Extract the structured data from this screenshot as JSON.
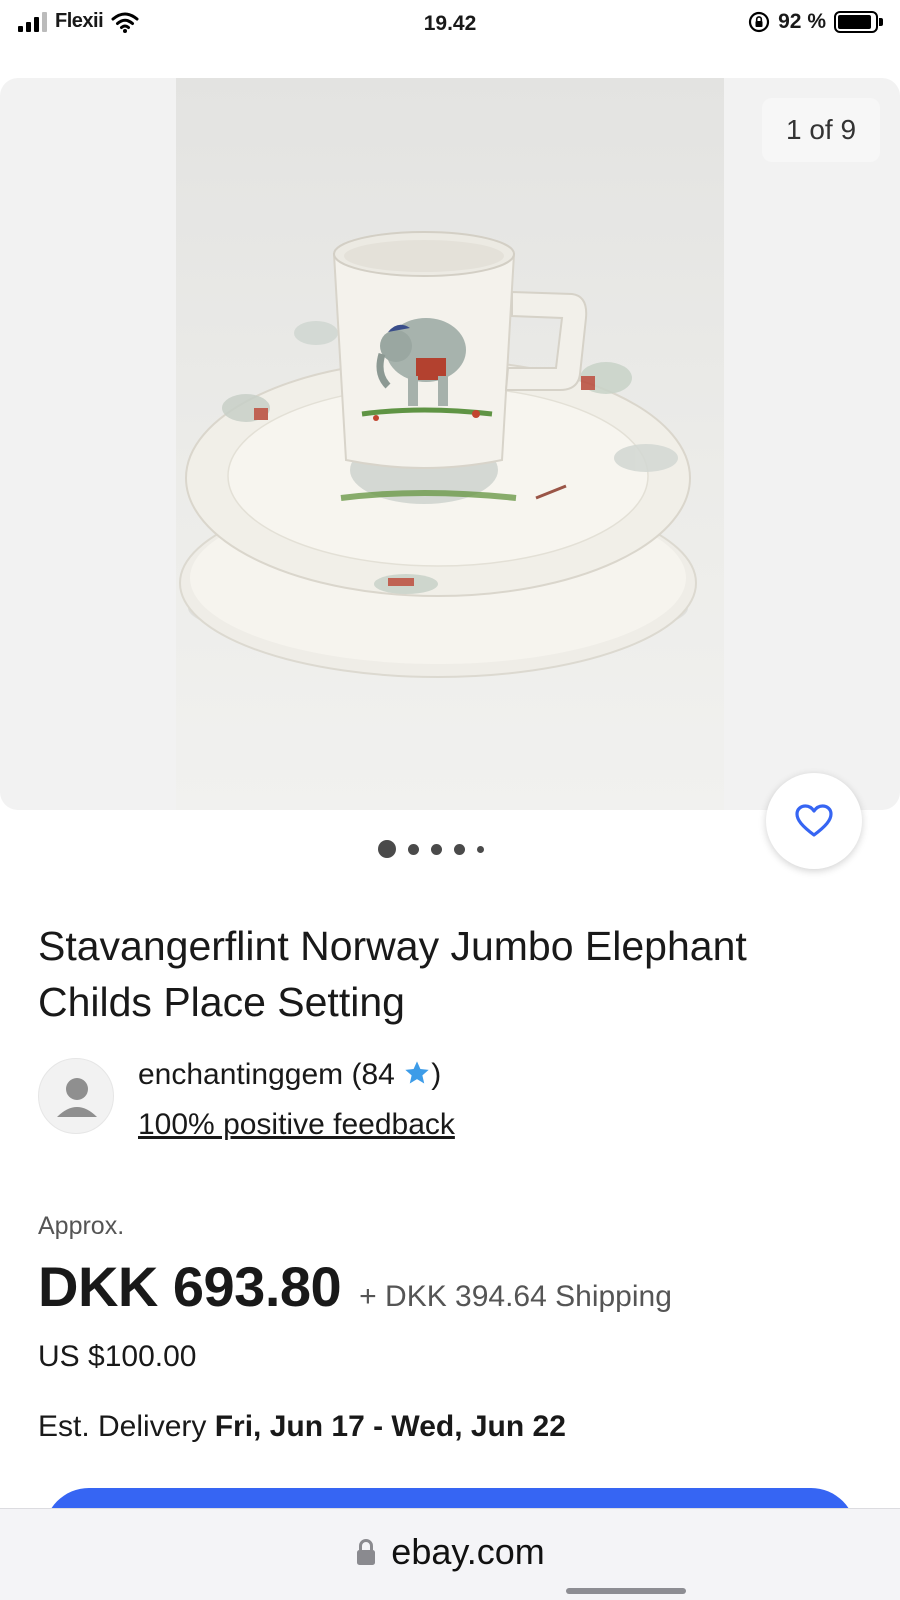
{
  "status_bar": {
    "carrier": "Flexii",
    "time": "19.42",
    "battery_text": "92 %",
    "battery_level": 0.92,
    "icons": [
      "signal-icon",
      "wifi-icon",
      "rotation-lock-icon",
      "battery-icon"
    ]
  },
  "gallery": {
    "counter": "1 of 9",
    "dots_total": 5,
    "active_dot": 0
  },
  "listing": {
    "title": "Stavangerflint Norway Jumbo Elephant Childs Place Setting",
    "seller": {
      "name_prefix": "enchantinggem (84 ",
      "name_suffix": ")",
      "star_icon": "star-icon",
      "star_color": "#3d9ce8",
      "feedback": "100% positive feedback"
    },
    "price": {
      "approx_label": "Approx.",
      "amount": "DKK 693.80",
      "shipping": "+ DKK 394.64 Shipping",
      "usd": "US $100.00"
    },
    "delivery": {
      "label": "Est. Delivery ",
      "dates": "Fri, Jun 17 - Wed, Jun 22"
    }
  },
  "browser": {
    "url": "ebay.com",
    "lock_icon": "lock-icon"
  },
  "colors": {
    "accent": "#3665f3",
    "favorite": "#3665f3"
  }
}
